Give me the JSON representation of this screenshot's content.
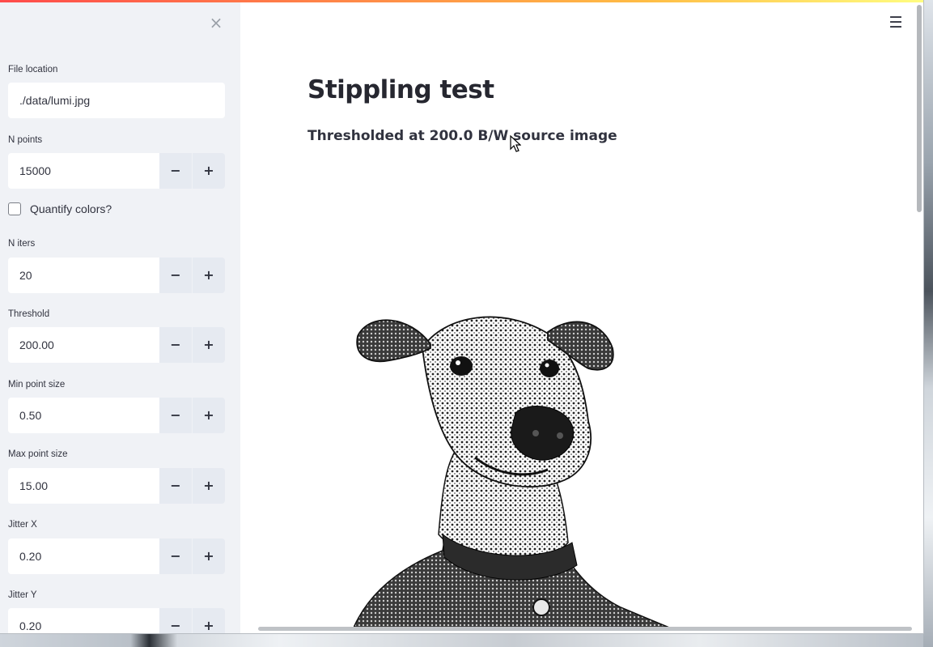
{
  "sidebar": {
    "close_icon": "×",
    "file_location": {
      "label": "File location",
      "value": "./data/lumi.jpg"
    },
    "n_points": {
      "label": "N points",
      "value": "15000"
    },
    "quantify_colors": {
      "label": "Quantify colors?",
      "checked": false
    },
    "n_iters": {
      "label": "N iters",
      "value": "20"
    },
    "threshold": {
      "label": "Threshold",
      "value": "200.00"
    },
    "min_point_size": {
      "label": "Min point size",
      "value": "0.50"
    },
    "max_point_size": {
      "label": "Max point size",
      "value": "15.00"
    },
    "jitter_x": {
      "label": "Jitter X",
      "value": "0.20"
    },
    "jitter_y": {
      "label": "Jitter Y",
      "value": "0.20"
    },
    "minus": "−",
    "plus": "+"
  },
  "main": {
    "menu_icon": "☰",
    "title": "Stippling test",
    "subtitle": "Thresholded at 200.0 B/W source image",
    "image_icon": "dog-image"
  },
  "colors": {
    "sidebar_bg": "#f0f2f6",
    "accent_gradient_start": "#ff4b4b",
    "accent_gradient_end": "#fffd80",
    "text": "#31333f"
  }
}
